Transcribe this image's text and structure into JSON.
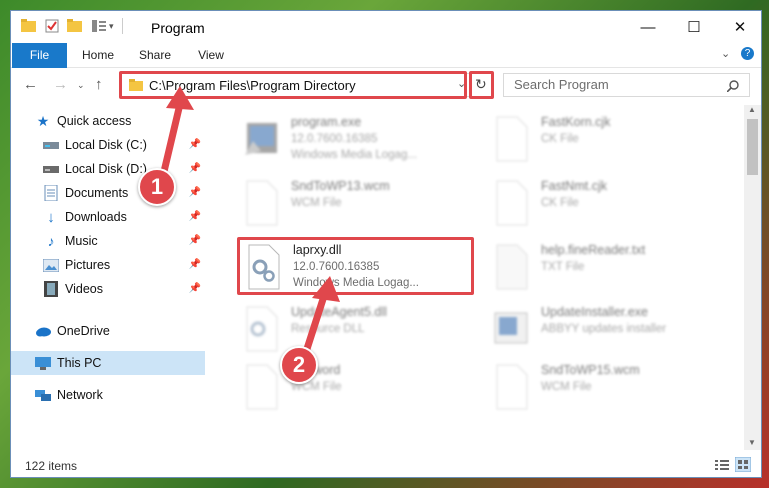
{
  "window": {
    "title": "Program",
    "controls": {
      "minimize": "—",
      "maximize": "☐",
      "close": "✕"
    }
  },
  "ribbon": {
    "tabs": [
      "File",
      "Home",
      "Share",
      "View"
    ]
  },
  "address": {
    "path": "C:\\Program Files\\Program Directory"
  },
  "search": {
    "placeholder": "Search Program"
  },
  "sidebar": {
    "items": [
      {
        "label": "Quick access"
      },
      {
        "label": "Local Disk (C:)"
      },
      {
        "label": "Local Disk (D:)"
      },
      {
        "label": "Documents"
      },
      {
        "label": "Downloads"
      },
      {
        "label": "Music"
      },
      {
        "label": "Pictures"
      },
      {
        "label": "Videos"
      },
      {
        "label": "OneDrive"
      },
      {
        "label": "This PC"
      },
      {
        "label": "Network"
      }
    ]
  },
  "files": [
    {
      "name": "program.exe",
      "line2": "12.0.7600.16385",
      "line3": "Windows Media Logag..."
    },
    {
      "name": "FastKorn.cjk",
      "line2": "CK File",
      "line3": ""
    },
    {
      "name": "SndToWP13.wcm",
      "line2": "WCM File",
      "line3": ""
    },
    {
      "name": "FastNmt.cjk",
      "line2": "CK File",
      "line3": ""
    },
    {
      "name": "laprxy.dll",
      "line2": "12.0.7600.16385",
      "line3": "Windows Media Logag..."
    },
    {
      "name": "help.fineReader.txt",
      "line2": "TXT File",
      "line3": ""
    },
    {
      "name": "UpdateAgent5.dll",
      "line2": "Resource DLL",
      "line3": ""
    },
    {
      "name": "UpdateInstaller.exe",
      "line2": "ABBYY updates installer",
      "line3": ""
    },
    {
      "name": "Sndword",
      "line2": "WCM File",
      "line3": ""
    },
    {
      "name": "SndToWP15.wcm",
      "line2": "WCM File",
      "line3": ""
    }
  ],
  "status": {
    "item_count": "122 items"
  },
  "callouts": {
    "step1": "1",
    "step2": "2"
  },
  "colors": {
    "accent": "#1979ca",
    "highlight": "#e0474c",
    "selected": "#cce4f7"
  }
}
